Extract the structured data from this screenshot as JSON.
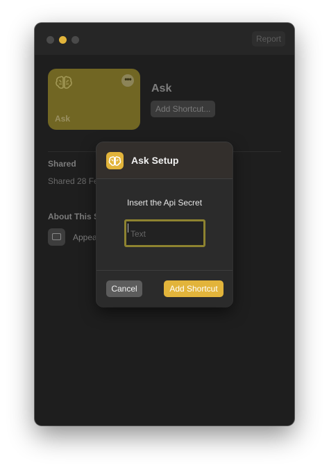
{
  "window": {
    "report_label": "Report"
  },
  "shortcut": {
    "card_label": "Ask",
    "title": "Ask",
    "add_button_label": "Add Shortcut...",
    "card_color": "#716623"
  },
  "details": {
    "shared_heading": "Shared",
    "shared_date": "Shared 28 Fe",
    "about_heading": "About This S",
    "appearance_label": "Appea"
  },
  "modal": {
    "title": "Ask Setup",
    "prompt": "Insert the Api Secret",
    "input_placeholder": "Text",
    "input_value": "",
    "cancel_label": "Cancel",
    "confirm_label": "Add Shortcut",
    "accent_color": "#e2b43b"
  },
  "icons": {
    "shortcut_icon": "brain-icon",
    "more_icon": "ellipsis-icon",
    "appearance_icon": "window-icon"
  }
}
